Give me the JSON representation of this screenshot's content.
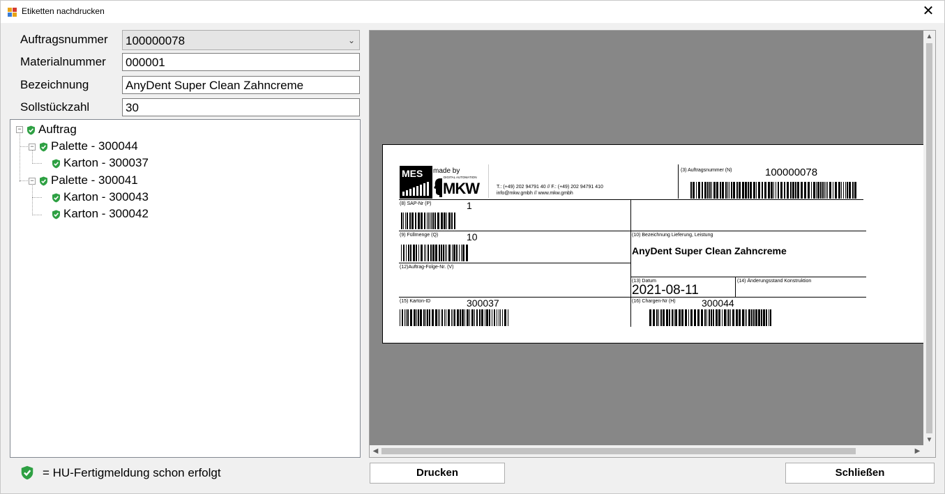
{
  "window": {
    "title": "Etiketten nachdrucken",
    "close": "✕"
  },
  "form": {
    "auftragsnummer_label": "Auftragsnummer",
    "auftragsnummer_value": "100000078",
    "materialnummer_label": "Materialnummer",
    "materialnummer_value": "000001",
    "bezeichnung_label": "Bezeichnung",
    "bezeichnung_value": "AnyDent Super Clean Zahncreme",
    "sollstueckzahl_label": "Sollstückzahl",
    "sollstueckzahl_value": "30"
  },
  "tree": {
    "root": "Auftrag",
    "palette1": "Palette - 300044",
    "karton1": "Karton - 300037",
    "palette2": "Palette - 300041",
    "karton2": "Karton - 300043",
    "karton3": "Karton - 300042"
  },
  "legend": {
    "text": "= HU-Fertigmeldung schon erfolgt"
  },
  "label": {
    "logo_mes": "MES",
    "logo_made_by": "made by",
    "logo_digital": "DIGITAL AUTOMATION",
    "logo_mkw": "MKW",
    "contact_line1": "T.: (+49) 202 94791 40 // F.: (+49) 202 94791 410",
    "contact_line2": "info@mkw.gmbh // www.mkw.gmbh",
    "auftragsnummer_title": "(3) Auftragsnummer (N)",
    "auftragsnummer_value": "100000078",
    "sap_title": "(8) SAP-Nr (P)",
    "sap_value": "1",
    "fuellmenge_title": "(9) Füllmenge (Q)",
    "fuellmenge_value": "10",
    "bezeichnung_title": "(10) Bezeichnung Lieferung, Leistung",
    "bezeichnung_value": "AnyDent Super Clean Zahncreme",
    "folge_title": "(12)Auftrag-Folge-Nr. (V)",
    "datum_title": "(13) Datum",
    "datum_value": "2021-08-11",
    "aenderung_title": "(14) Änderungsstand Konstruktion",
    "karton_title": "(15) Karton-ID",
    "karton_value": "300037",
    "chargen_title": "(16) Chargen-Nr (H)",
    "chargen_value": "300044"
  },
  "buttons": {
    "drucken": "Drucken",
    "schliessen": "Schließen"
  },
  "colors": {
    "shield": "#2ea043",
    "preview_bg": "#878787"
  }
}
